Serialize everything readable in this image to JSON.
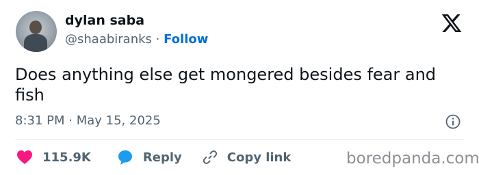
{
  "author": {
    "name": "dylan saba",
    "handle": "@shaabiranks",
    "separator": " · ",
    "follow_label": "Follow"
  },
  "tweet": {
    "text": "Does anything else get mongered besides fear and fish",
    "time": "8:31 PM",
    "date_separator": " · ",
    "date": "May 15, 2025"
  },
  "actions": {
    "likes_count": "115.9K",
    "reply_label": "Reply",
    "copy_link_label": "Copy link"
  },
  "watermark": "boredpanda.com",
  "icons": {
    "logo": "x-logo-icon",
    "info": "info-icon",
    "like": "heart-icon",
    "reply": "reply-bubble-icon",
    "copy": "link-icon"
  },
  "colors": {
    "text": "#0f1419",
    "secondary": "#536471",
    "follow": "#006fd6",
    "like": "#f91880",
    "reply": "#1d9bf0",
    "divider": "#e6ecf0",
    "watermark": "#8b9095"
  }
}
